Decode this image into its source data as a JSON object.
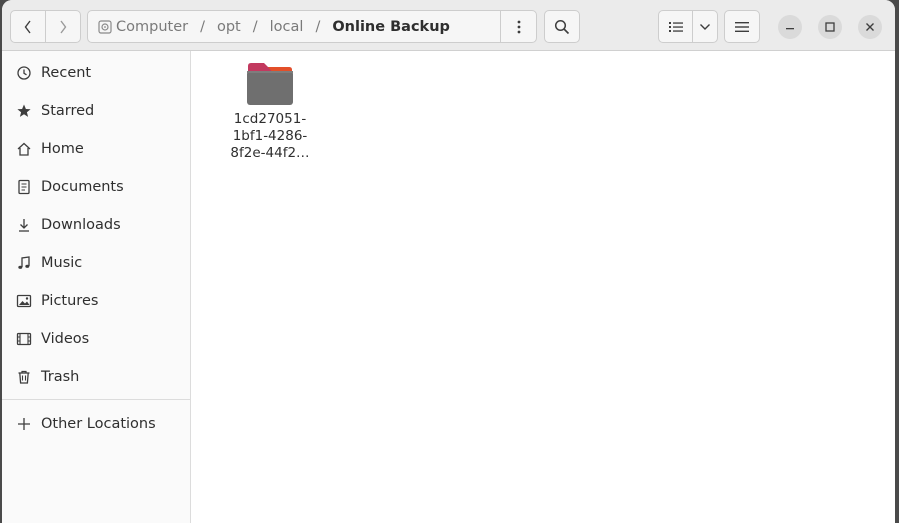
{
  "window": {
    "title": "Online Backup"
  },
  "header": {
    "breadcrumbs": [
      "Computer",
      "opt",
      "local",
      "Online Backup"
    ],
    "nav_back_icon": "chevron-left-icon",
    "nav_forward_icon": "chevron-right-icon",
    "path_menu_icon": "vertical-dots-icon",
    "search_icon": "search-icon",
    "view_icon": "list-view-icon",
    "view_menu_icon": "chevron-down-icon",
    "main_menu_icon": "hamburger-icon",
    "window_controls": [
      "minimize",
      "maximize",
      "close"
    ]
  },
  "sidebar": {
    "items": [
      {
        "label": "Recent",
        "icon": "clock-icon"
      },
      {
        "label": "Starred",
        "icon": "star-icon"
      },
      {
        "label": "Home",
        "icon": "home-icon"
      },
      {
        "label": "Documents",
        "icon": "document-icon"
      },
      {
        "label": "Downloads",
        "icon": "download-icon"
      },
      {
        "label": "Music",
        "icon": "music-icon"
      },
      {
        "label": "Pictures",
        "icon": "picture-icon"
      },
      {
        "label": "Videos",
        "icon": "video-icon"
      },
      {
        "label": "Trash",
        "icon": "trash-icon"
      }
    ],
    "other_locations": {
      "label": "Other Locations",
      "icon": "plus-icon"
    }
  },
  "main": {
    "files": [
      {
        "name_lines": [
          "1cd27051-",
          "1bf1-4286-",
          "8f2e-44f2…"
        ],
        "type": "folder"
      }
    ]
  },
  "colors": {
    "folder_body": "#6f6f6f",
    "folder_tab": "#c2395f",
    "folder_accent": "#e95420"
  }
}
